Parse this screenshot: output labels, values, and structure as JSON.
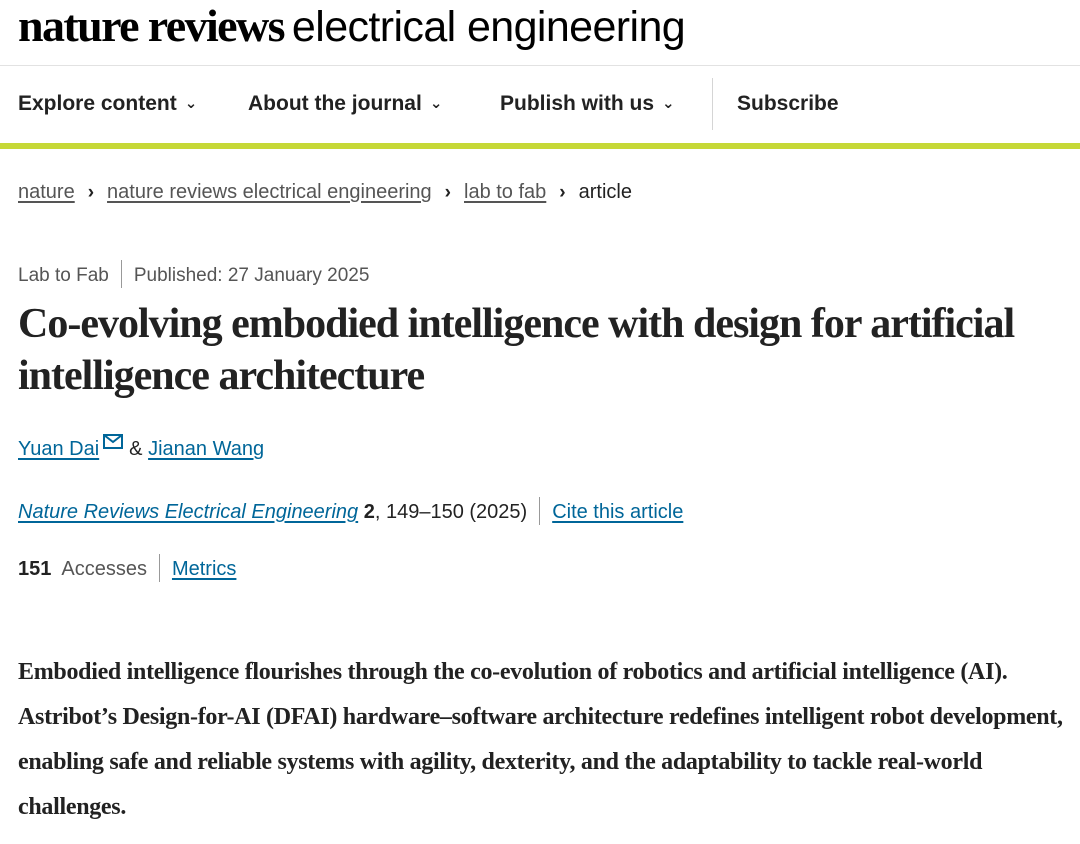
{
  "masthead": {
    "brand_bold": "nature reviews",
    "brand_light": "electrical engineering"
  },
  "nav": {
    "items": [
      {
        "label": "Explore content"
      },
      {
        "label": "About the journal"
      },
      {
        "label": "Publish with us"
      }
    ],
    "subscribe": "Subscribe"
  },
  "breadcrumb": [
    "nature",
    "nature reviews electrical engineering",
    "lab to fab",
    "article"
  ],
  "article": {
    "type": "Lab to Fab",
    "published": "Published: 27 January 2025",
    "title": "Co-evolving embodied intelligence with design for artificial intelligence architecture",
    "authors": [
      "Yuan Dai",
      "Jianan Wang"
    ],
    "author_conj": "&",
    "journal": "Nature Reviews Electrical Engineering",
    "volume": "2",
    "pages_year": ", 149–150 (2025)",
    "cite": "Cite this article",
    "accesses_count": "151",
    "accesses_label": "Accesses",
    "metrics": "Metrics",
    "abstract": "Embodied intelligence flourishes through the co-evolution of robotics and artificial intelligence (AI). Astribot’s Design-for-AI (DFAI) hardware–software architecture redefines intelligent robot development, enabling safe and reliable systems with agility, dexterity, and the adaptability to tackle real-world challenges."
  },
  "colors": {
    "accent_bar": "#c6d837",
    "link": "#006699",
    "text": "#222222"
  },
  "icons": [
    "chevron-down-icon",
    "chevron-right-icon",
    "mail-icon"
  ]
}
